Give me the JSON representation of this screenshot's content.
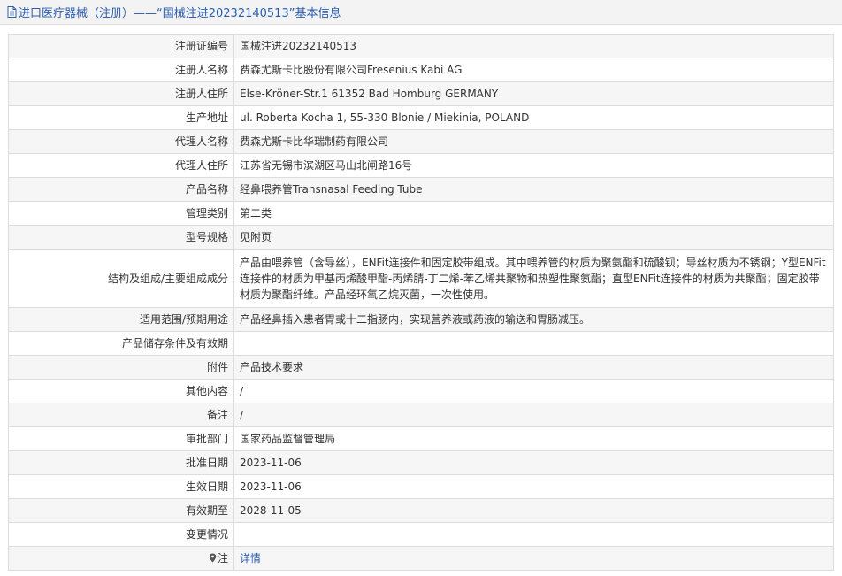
{
  "header": {
    "title": "进口医疗器械（注册）——“国械注进20232140513”基本信息",
    "icon": "document-icon",
    "colors": {
      "title": "#2a5db0",
      "bar": "#f3f3f3"
    }
  },
  "rows": [
    {
      "label": "注册证编号",
      "value": "国械注进20232140513"
    },
    {
      "label": "注册人名称",
      "value": "费森尤斯卡比股份有限公司Fresenius Kabi AG"
    },
    {
      "label": "注册人住所",
      "value": "Else-Kröner-Str.1 61352 Bad Homburg GERMANY"
    },
    {
      "label": "生产地址",
      "value": "ul. Roberta Kocha 1, 55-330 Blonie / Miekinia, POLAND"
    },
    {
      "label": "代理人名称",
      "value": "费森尤斯卡比华瑞制药有限公司"
    },
    {
      "label": "代理人住所",
      "value": "江苏省无锡市滨湖区马山北闸路16号"
    },
    {
      "label": "产品名称",
      "value": "经鼻喂养管Transnasal Feeding Tube"
    },
    {
      "label": "管理类别",
      "value": "第二类"
    },
    {
      "label": "型号规格",
      "value": "见附页"
    },
    {
      "label": "结构及组成/主要组成成分",
      "value": "产品由喂养管（含导丝），ENFit连接件和固定胶带组成。其中喂养管的材质为聚氨酯和硫酸钡；导丝材质为不锈钢；Y型ENFit连接件的材质为甲基丙烯酸甲酯-丙烯腈-丁二烯-苯乙烯共聚物和热塑性聚氨酯；直型ENFit连接件的材质为共聚酯；固定胶带材质为聚酯纤维。产品经环氧乙烷灭菌，一次性使用。"
    },
    {
      "label": "适用范围/预期用途",
      "value": "产品经鼻插入患者胃或十二指肠内，实现营养液或药液的输送和胃肠减压。"
    },
    {
      "label": "产品储存条件及有效期",
      "value": ""
    },
    {
      "label": "附件",
      "value": "产品技术要求"
    },
    {
      "label": "其他内容",
      "value": "/"
    },
    {
      "label": "备注",
      "value": "/"
    },
    {
      "label": "审批部门",
      "value": "国家药品监督管理局"
    },
    {
      "label": "批准日期",
      "value": "2023-11-06"
    },
    {
      "label": "生效日期",
      "value": "2023-11-06"
    },
    {
      "label": "有效期至",
      "value": "2028-11-05"
    },
    {
      "label": "变更情况",
      "value": ""
    }
  ],
  "note": {
    "label": "注",
    "icon": "pin-icon",
    "link": "详情"
  }
}
